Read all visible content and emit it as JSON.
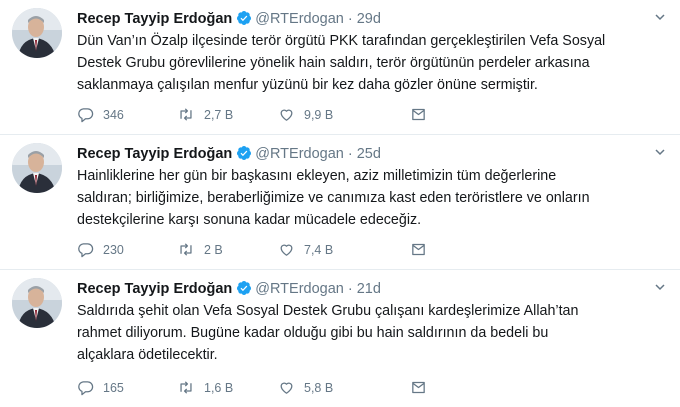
{
  "tweets": [
    {
      "name": "Recep Tayyip Erdoğan",
      "handle": "@RTErdogan",
      "separator": "·",
      "time": "29d",
      "lines": [
        "Dün Van’ın Özalp ilçesinde terör örgütü PKK tarafından gerçekleştirilen Vefa Sosyal",
        "Destek Grubu görevlilerine yönelik hain saldırı, terör örgütünün perdeler arkasına",
        "saklanmaya çalışılan menfur yüzünü bir kez daha gözler önüne sermiştir."
      ],
      "replies": "346",
      "retweets": "2,7 B",
      "likes": "9,9 B"
    },
    {
      "name": "Recep Tayyip Erdoğan",
      "handle": "@RTErdogan",
      "separator": "·",
      "time": "25d",
      "lines": [
        "Hainliklerine her gün bir başkasını ekleyen, aziz milletimizin tüm değerlerine",
        "saldıran; birliğimize, beraberliğimize ve canımıza kast eden teröristlere ve onların",
        "destekçilerine karşı sonuna kadar mücadele edeceğiz."
      ],
      "replies": "230",
      "retweets": "2 B",
      "likes": "7,4 B"
    },
    {
      "name": "Recep Tayyip Erdoğan",
      "handle": "@RTErdogan",
      "separator": "·",
      "time": "21d",
      "lines": [
        "Saldırıda şehit olan Vefa Sosyal Destek Grubu çalışanı kardeşlerimize Allah’tan",
        "rahmet diliyorum. Bugüne kadar olduğu gibi bu hain saldırının da bedeli bu",
        "alçaklara ödetilecektir."
      ],
      "replies": "165",
      "retweets": "1,6 B",
      "likes": "5,8 B"
    }
  ],
  "colors": {
    "verified": "#1da1f2",
    "secondary_text": "#657786",
    "divider": "#e6ecf0"
  },
  "icons": [
    "verified-badge-icon",
    "chevron-down-icon",
    "reply-icon",
    "retweet-icon",
    "like-icon",
    "direct-message-icon"
  ]
}
